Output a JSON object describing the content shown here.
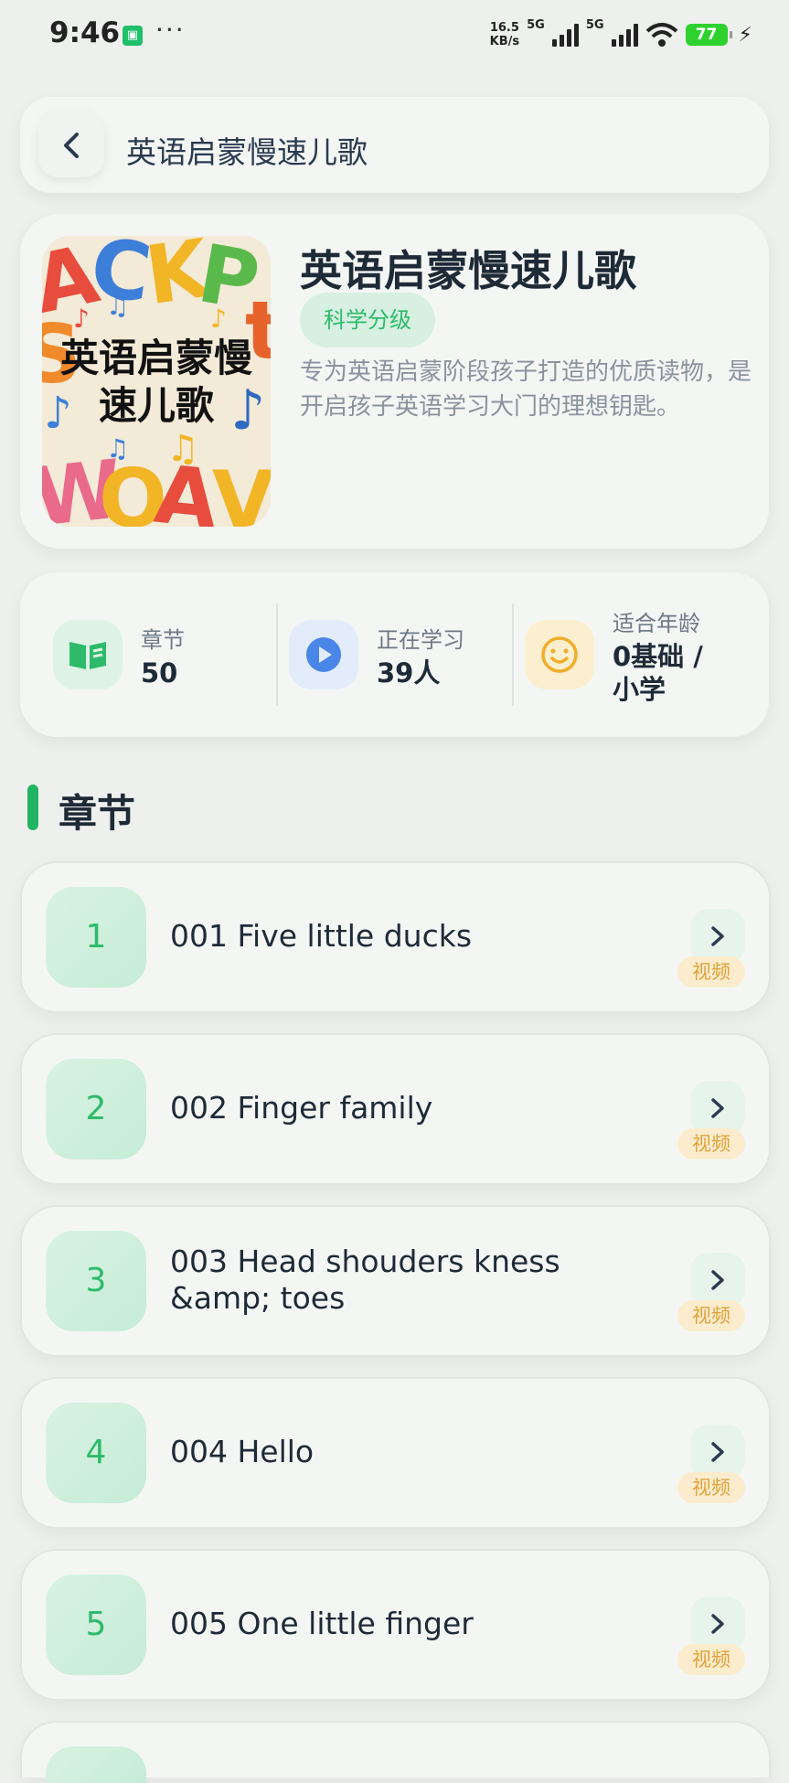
{
  "status_bar": {
    "time": "9:46",
    "speed_top": "16.5",
    "speed_unit": "KB/s",
    "network_1": "5G",
    "network_2": "5G",
    "battery": "77"
  },
  "header": {
    "title": "英语启蒙慢速儿歌"
  },
  "book": {
    "cover_text": "英语启蒙慢速儿歌",
    "title": "英语启蒙慢速儿歌",
    "tag": "科学分级",
    "description": "专为英语启蒙阶段孩子打造的优质读物，是开启孩子英语学习大门的理想钥匙。"
  },
  "stats": {
    "chapters": {
      "label": "章节",
      "value": "50"
    },
    "learners": {
      "label": "正在学习",
      "value": "39人"
    },
    "age": {
      "label": "适合年龄",
      "value": "0基础 / 小学"
    }
  },
  "section": {
    "title": "章节"
  },
  "chapters": [
    {
      "num": "1",
      "title": "001 Five  little ducks",
      "badge": "视频"
    },
    {
      "num": "2",
      "title": "002 Finger family",
      "badge": "视频"
    },
    {
      "num": "3",
      "title": "003 Head shouders kness &amp; toes",
      "badge": "视频"
    },
    {
      "num": "4",
      "title": "004 Hello",
      "badge": "视频"
    },
    {
      "num": "5",
      "title": "005 One little finger",
      "badge": "视频"
    }
  ],
  "colors": {
    "accent": "#2dbb6b",
    "badge": "#e1a23b",
    "background": "#eef0ee"
  }
}
